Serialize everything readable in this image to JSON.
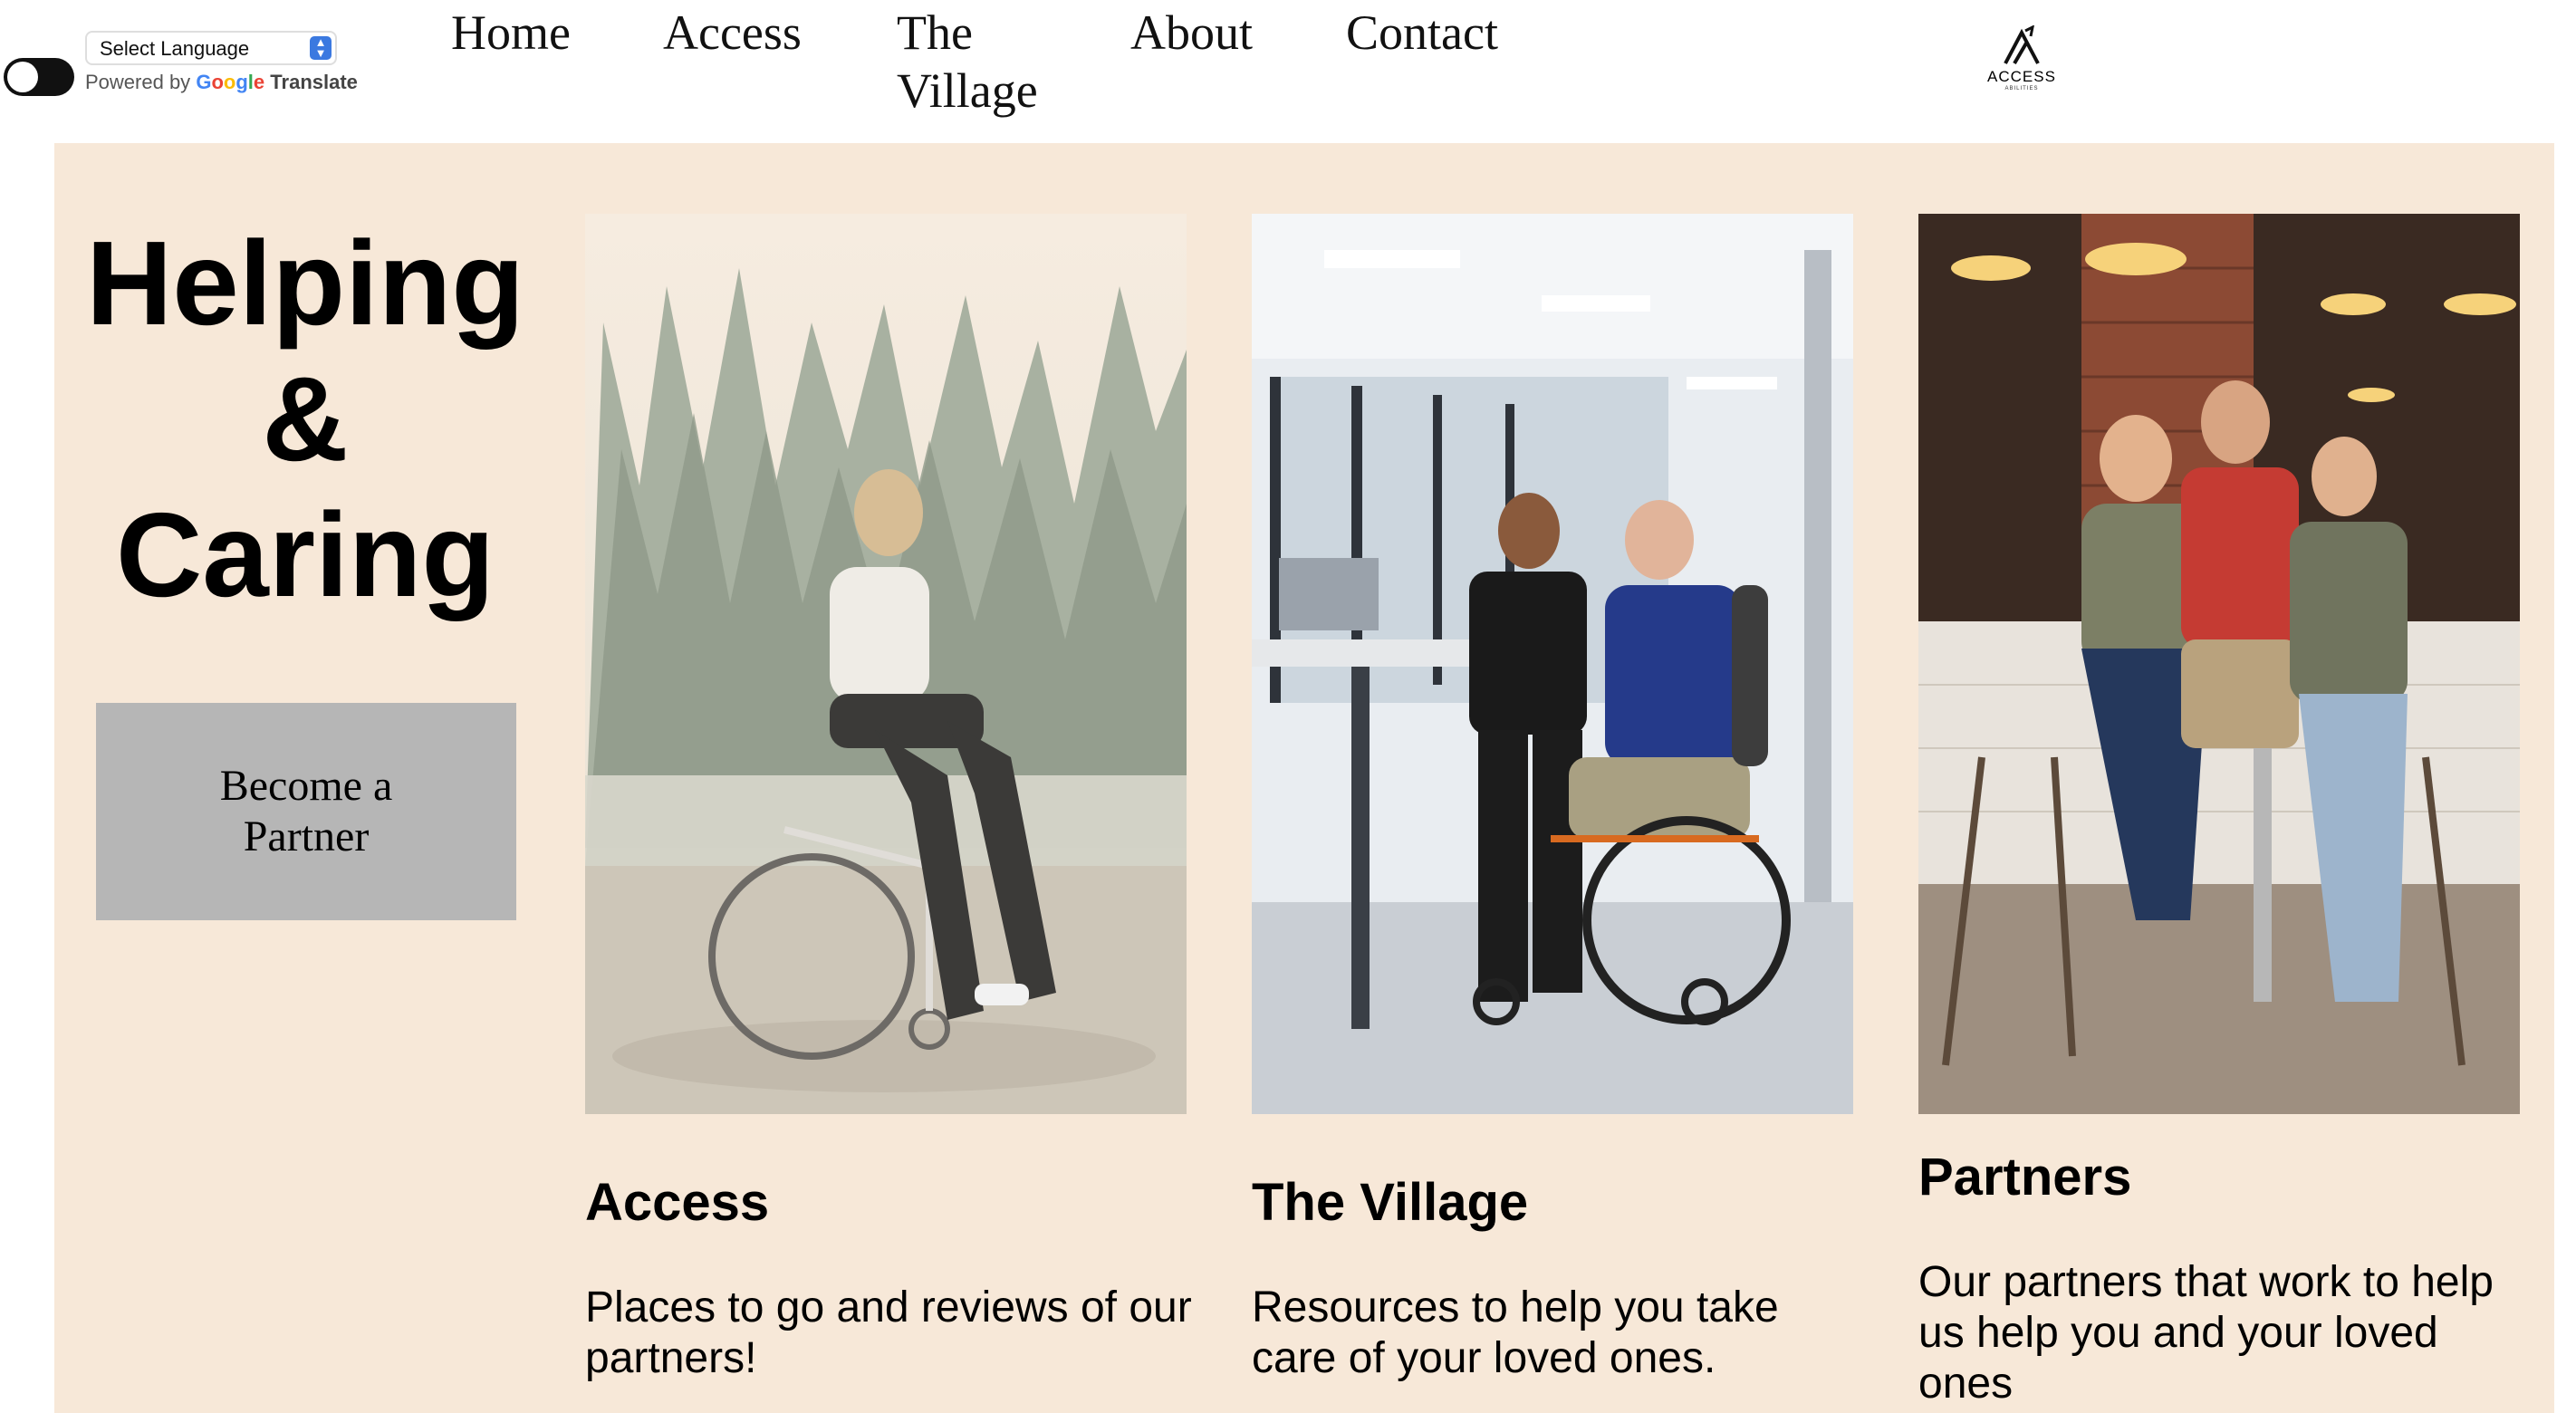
{
  "translate": {
    "select_label": "Select Language",
    "powered_by": "Powered by",
    "google": "Google",
    "translate_word": "Translate"
  },
  "nav": {
    "home": "Home",
    "access": "Access",
    "village_line1": "The",
    "village_line2": "Village",
    "about": "About",
    "contact": "Contact"
  },
  "logo": {
    "word": "ACCESS",
    "sub": "ABILITIES"
  },
  "hero": {
    "line1": "Helping",
    "line2": "&",
    "line3": "Caring",
    "button_line1": "Become a",
    "button_line2": "Partner"
  },
  "cards": [
    {
      "title": "Access",
      "text": "Places to go and reviews of our partners!"
    },
    {
      "title": "The Village",
      "text": "Resources to help you take care of your loved ones."
    },
    {
      "title": "Partners",
      "text": "Our partners that work to help us help you and your loved ones"
    }
  ],
  "colors": {
    "panel": "#f7e8d8",
    "button": "#b6b6b6",
    "select_accent": "#3b79e0"
  },
  "icons": [
    "dark-mode-toggle-icon",
    "select-arrows-icon",
    "access-logo-icon"
  ]
}
